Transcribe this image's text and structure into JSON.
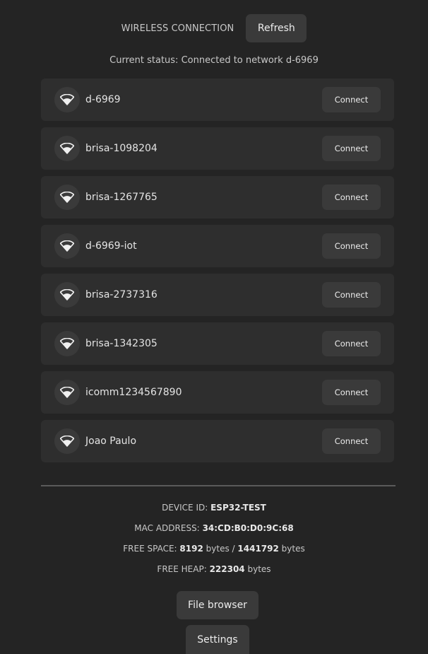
{
  "header": {
    "title": "WIRELESS CONNECTION",
    "refresh_label": "Refresh"
  },
  "status": {
    "text": "Current status: Connected to network d-6969"
  },
  "networks": [
    {
      "ssid": "d-6969",
      "action": "Connect",
      "icon": "wifi-icon"
    },
    {
      "ssid": "brisa-1098204",
      "action": "Connect",
      "icon": "wifi-icon"
    },
    {
      "ssid": "brisa-1267765",
      "action": "Connect",
      "icon": "wifi-icon"
    },
    {
      "ssid": "d-6969-iot",
      "action": "Connect",
      "icon": "wifi-icon"
    },
    {
      "ssid": "brisa-2737316",
      "action": "Connect",
      "icon": "wifi-icon"
    },
    {
      "ssid": "brisa-1342305",
      "action": "Connect",
      "icon": "wifi-icon"
    },
    {
      "ssid": "icomm1234567890",
      "action": "Connect",
      "icon": "wifi-icon"
    },
    {
      "ssid": "Joao Paulo",
      "action": "Connect",
      "icon": "wifi-icon"
    }
  ],
  "device_info": {
    "device_id_label": "DEVICE ID:",
    "device_id": "ESP32-TEST",
    "mac_label": "MAC ADDRESS:",
    "mac": "34:CD:B0:D0:9C:68",
    "free_space_label": "FREE SPACE:",
    "free_space_used": "8192",
    "free_space_sep": "bytes /",
    "free_space_total": "1441792",
    "free_space_unit": "bytes",
    "free_heap_label": "FREE HEAP:",
    "free_heap": "222304",
    "free_heap_unit": "bytes"
  },
  "actions": {
    "file_browser_label": "File browser",
    "settings_label": "Settings"
  },
  "colors": {
    "background": "#242424",
    "card": "#2e2e2e",
    "button": "#3a3a3a"
  }
}
